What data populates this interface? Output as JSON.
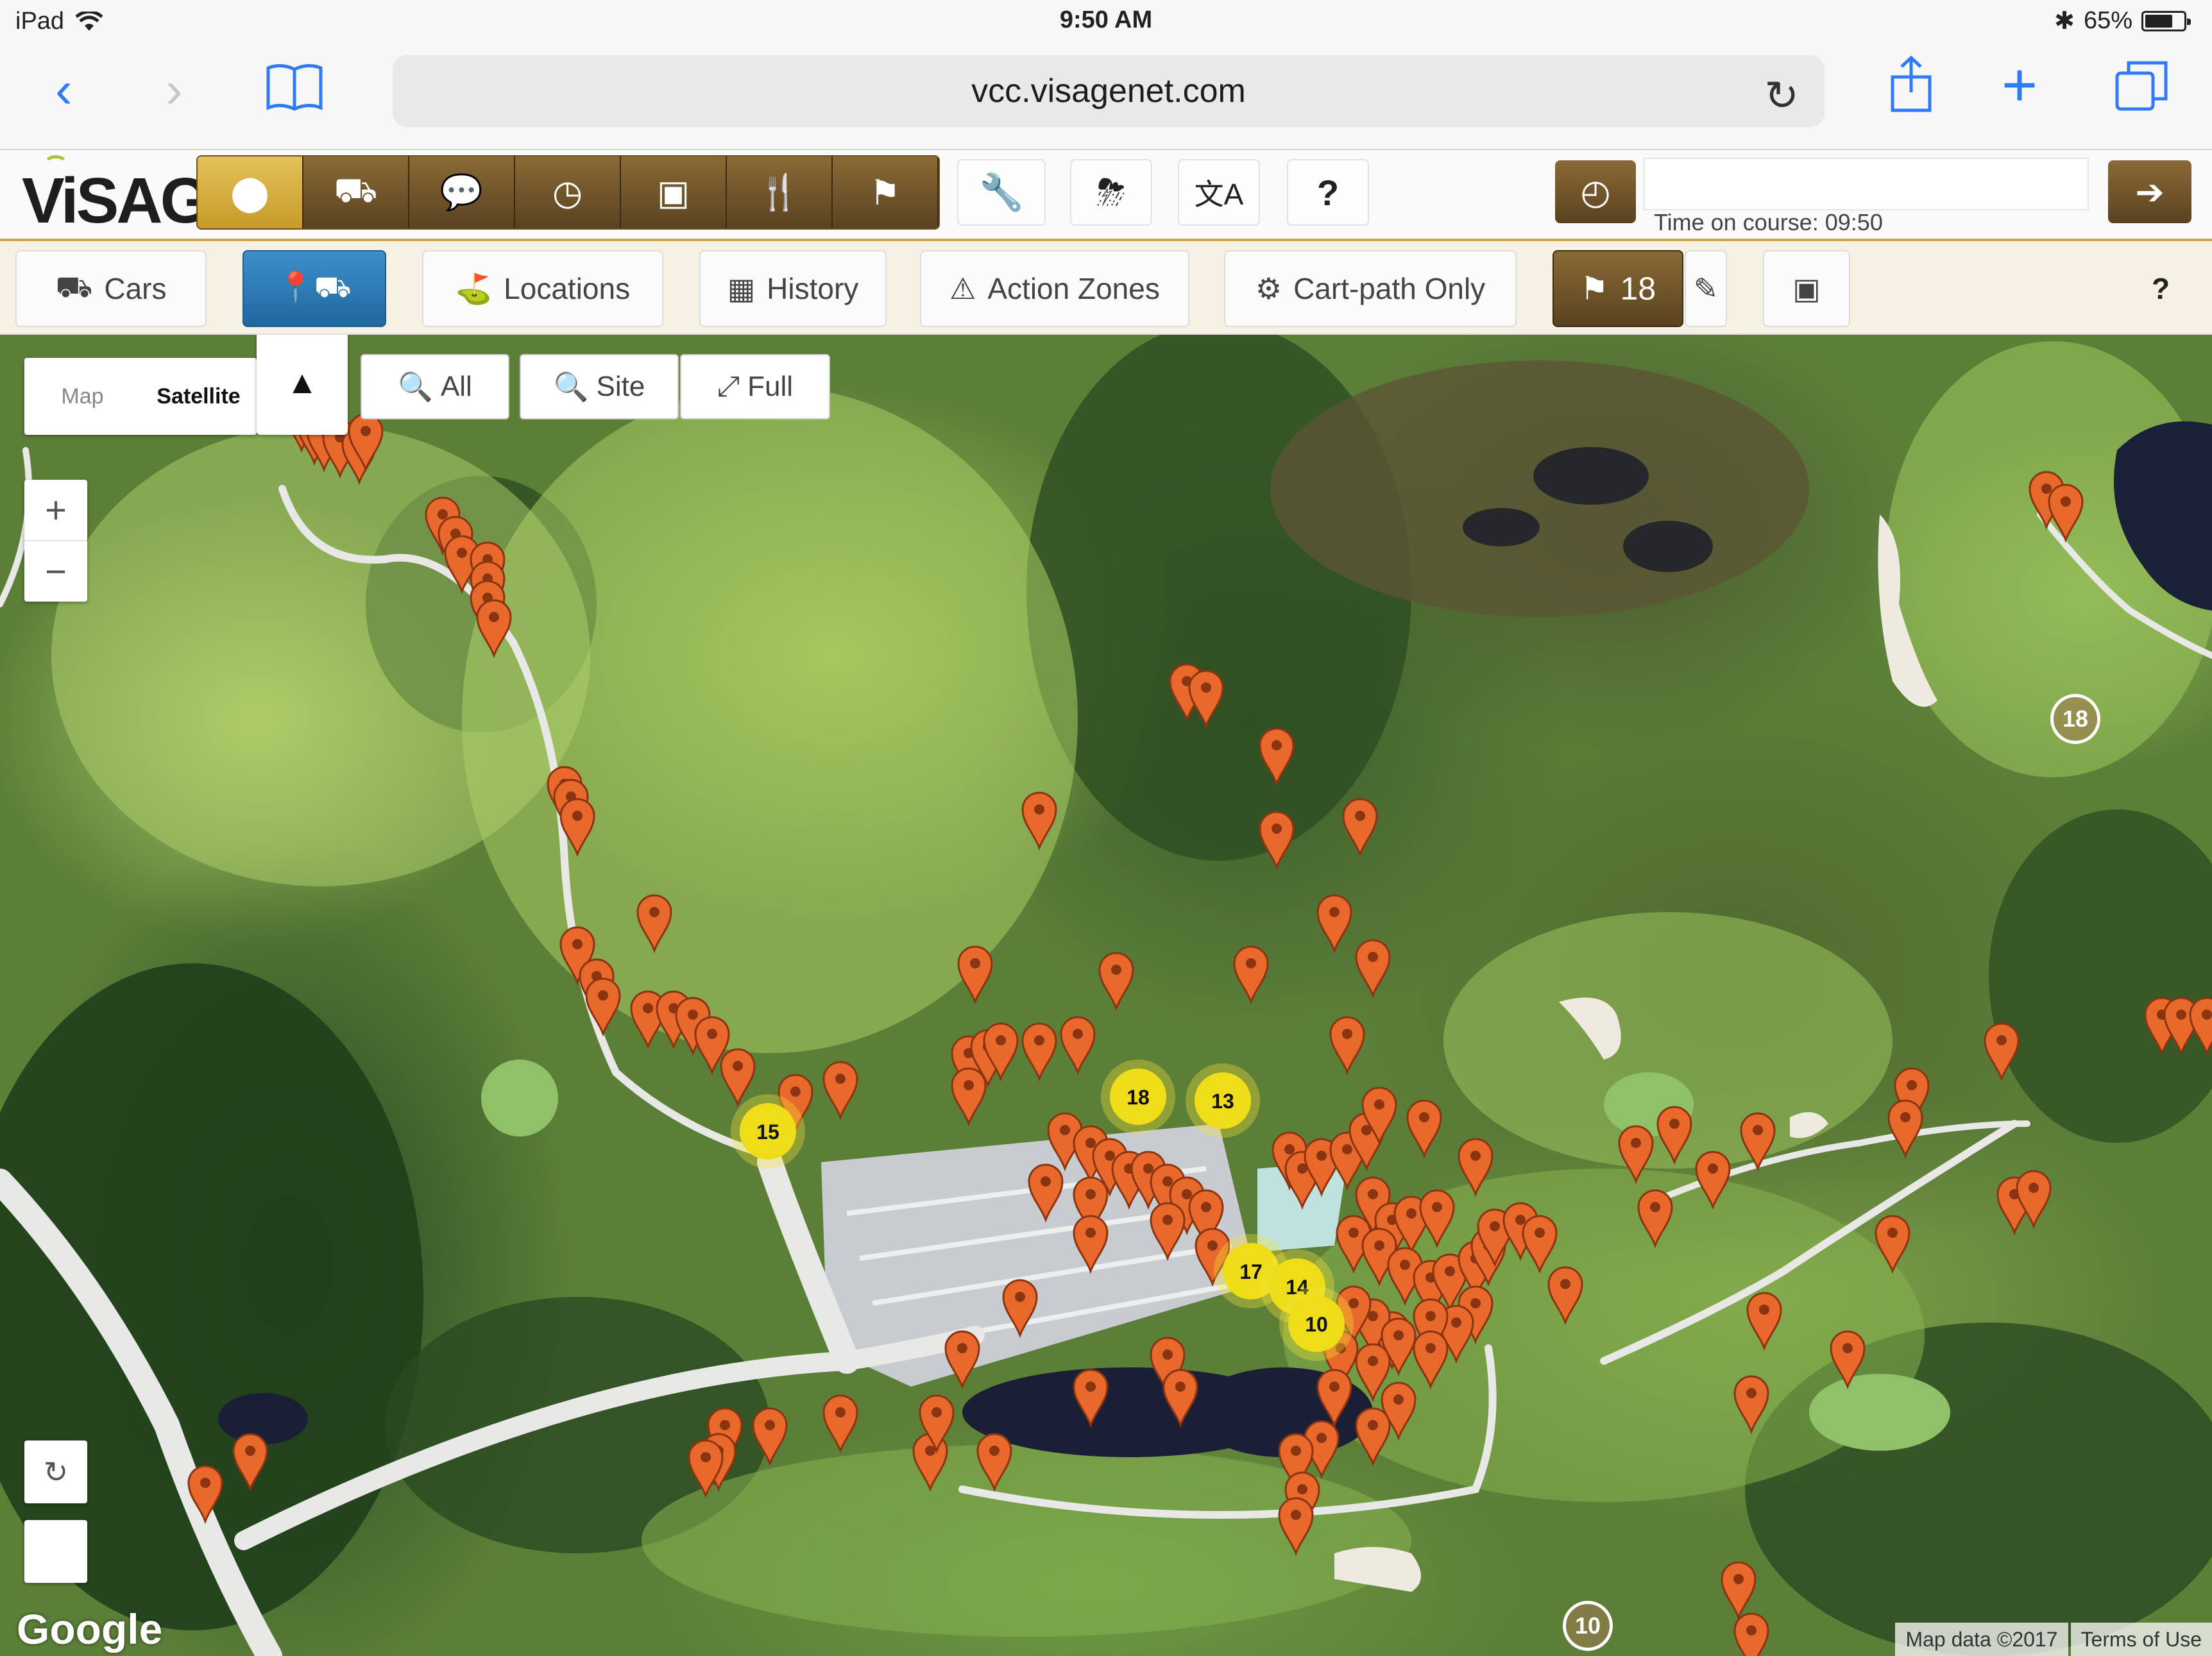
{
  "status_bar": {
    "device": "iPad",
    "time": "9:50 AM",
    "battery": "65%",
    "battery_level": 0.65
  },
  "browser": {
    "url": "vcc.visagenet.com"
  },
  "app": {
    "logo": "ViSAGE",
    "logo_tm": "™",
    "time_on_course_label": "Time on course: 09:50",
    "help_label": "?"
  },
  "subnav": {
    "cars": "Cars",
    "locations": "Locations",
    "history": "History",
    "action_zones": "Action Zones",
    "cart_path_only": "Cart-path Only",
    "hole": "18",
    "help": "?"
  },
  "map": {
    "type_map": "Map",
    "type_satellite": "Satellite",
    "search_all": "All",
    "search_site": "Site",
    "search_full": "Full",
    "zoom_in": "+",
    "zoom_out": "−",
    "google": "Google",
    "map_data": "Map data ©2017",
    "terms": "Terms of Use",
    "hole_markers": [
      "18",
      "10"
    ],
    "clusters": [
      "15",
      "18",
      "13",
      "17",
      "14",
      "10"
    ]
  }
}
